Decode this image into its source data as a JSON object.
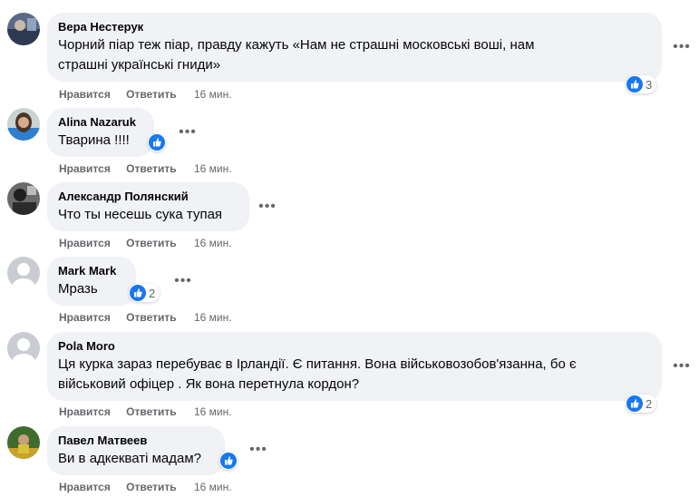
{
  "actions": {
    "like_label": "Нравится",
    "reply_label": "Ответить"
  },
  "comments": [
    {
      "author": "Вера Нестерук",
      "text_lines": [
        "Чорний піар теж піар, правду кажуть «Нам не страшні московські воші, нам",
        "страшні українські гниди»"
      ],
      "reactions": "3",
      "time": "16 мин.",
      "avatar_icon": "user-photo-icon"
    },
    {
      "author": "Alina Nazaruk",
      "text_lines": [
        "Тварина !!!!"
      ],
      "reactions": "",
      "time": "16 мин.",
      "avatar_icon": "user-photo-icon"
    },
    {
      "author": "Александр Полянский",
      "text_lines": [
        "Что ты несешь сука тупая"
      ],
      "reactions": "",
      "time": "16 мин.",
      "avatar_icon": "user-photo-icon"
    },
    {
      "author": "Mark Mark",
      "text_lines": [
        "Мразь"
      ],
      "reactions": "2",
      "time": "16 мин.",
      "avatar_icon": "default-avatar-icon"
    },
    {
      "author": "Pola Moro",
      "text_lines": [
        "Ця курка зараз перебуває в Ірландії. Є питання. Вона військовозобов'язанна, бо є",
        "військовий офіцер . Як вона перетнула кордон?"
      ],
      "reactions": "2",
      "time": "16 мин.",
      "avatar_icon": "default-avatar-icon"
    },
    {
      "author": "Павел Матвеев",
      "text_lines": [
        "Ви в адкекваті мадам?"
      ],
      "reactions": "",
      "time": "16 мин.",
      "avatar_icon": "user-photo-icon"
    }
  ],
  "colors": {
    "bubble": "#f0f2f5",
    "like_blue": "#1877f2",
    "secondary_text": "#65676b"
  }
}
